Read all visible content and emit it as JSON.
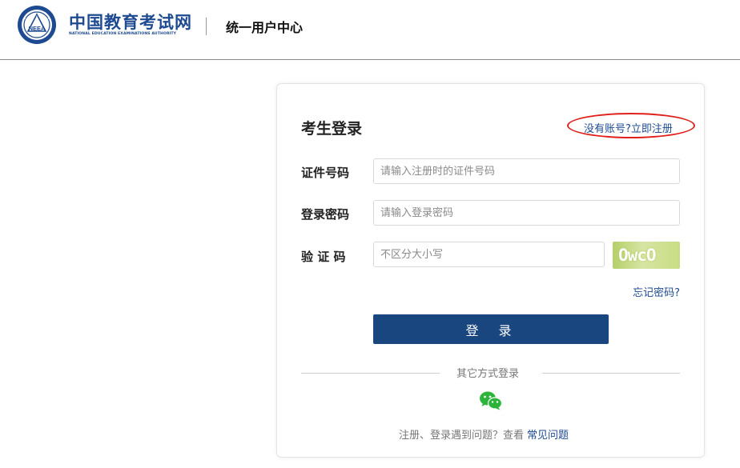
{
  "header": {
    "logo_cn": "中国教育考试网",
    "logo_en": "NATIONAL EDUCATION EXAMINATIONS AUTHORITY",
    "emblem_text": "NEEA",
    "subtitle": "统一用户中心"
  },
  "login": {
    "title": "考生登录",
    "register_link": "没有账号?立即注册",
    "fields": {
      "id_label": "证件号码",
      "id_placeholder": "请输入注册时的证件号码",
      "password_label": "登录密码",
      "password_placeholder": "请输入登录密码",
      "captcha_label": "验 证 码",
      "captcha_placeholder": "不区分大小写",
      "captcha_image_text": "OwcO"
    },
    "forgot_password": "忘记密码?",
    "submit_label": "登 录",
    "alt_login_text": "其它方式登录",
    "help_text": "注册、登录遇到问题？查看",
    "help_link": "常见问题"
  },
  "colors": {
    "brand_blue": "#1d4a90",
    "button_blue": "#1a4680",
    "annotation_red": "#e0201b",
    "wechat_green": "#2bb33a"
  },
  "icons": {
    "emblem": "neea-emblem-icon",
    "wechat": "wechat-icon"
  }
}
